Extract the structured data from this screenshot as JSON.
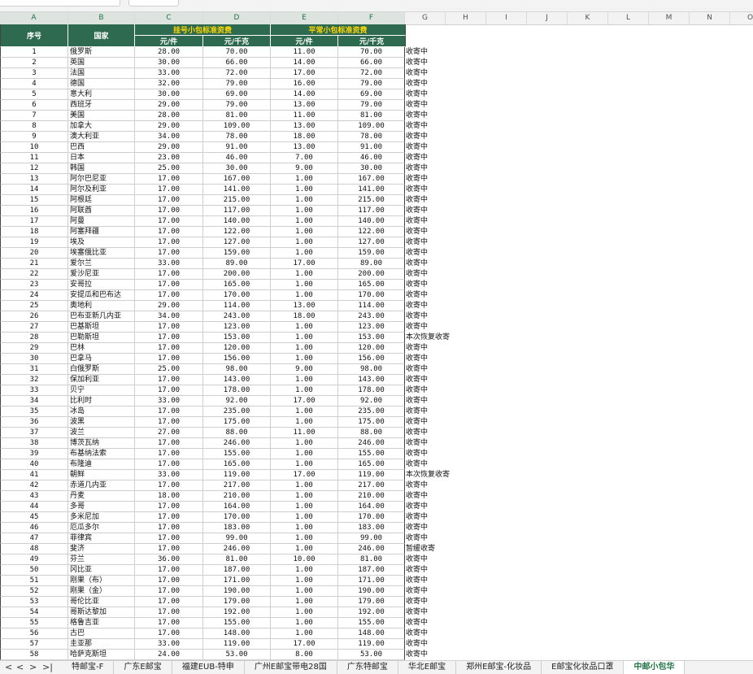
{
  "columns": [
    "A",
    "B",
    "C",
    "D",
    "E",
    "F",
    "G",
    "H",
    "I",
    "J",
    "K",
    "L",
    "M",
    "N",
    "O"
  ],
  "header": {
    "seq": "序号",
    "country": "国家",
    "group1": "挂号小包标准资费",
    "group2": "平常小包标准资费",
    "unit_piece": "元/件",
    "unit_kg": "元/千克"
  },
  "rows": [
    [
      "1",
      "俄罗斯",
      "28.00",
      "70.00",
      "11.00",
      "70.00",
      "收寄中"
    ],
    [
      "2",
      "英国",
      "30.00",
      "66.00",
      "14.00",
      "66.00",
      "收寄中"
    ],
    [
      "3",
      "法国",
      "33.00",
      "72.00",
      "17.00",
      "72.00",
      "收寄中"
    ],
    [
      "4",
      "德国",
      "32.00",
      "79.00",
      "16.00",
      "79.00",
      "收寄中"
    ],
    [
      "5",
      "意大利",
      "30.00",
      "69.00",
      "14.00",
      "69.00",
      "收寄中"
    ],
    [
      "6",
      "西班牙",
      "29.00",
      "79.00",
      "13.00",
      "79.00",
      "收寄中"
    ],
    [
      "7",
      "美国",
      "28.00",
      "81.00",
      "11.00",
      "81.00",
      "收寄中"
    ],
    [
      "8",
      "加拿大",
      "29.00",
      "109.00",
      "13.00",
      "109.00",
      "收寄中"
    ],
    [
      "9",
      "澳大利亚",
      "34.00",
      "78.00",
      "18.00",
      "78.00",
      "收寄中"
    ],
    [
      "10",
      "巴西",
      "29.00",
      "91.00",
      "13.00",
      "91.00",
      "收寄中"
    ],
    [
      "11",
      "日本",
      "23.00",
      "46.00",
      "7.00",
      "46.00",
      "收寄中"
    ],
    [
      "12",
      "韩国",
      "25.00",
      "30.00",
      "9.00",
      "30.00",
      "收寄中"
    ],
    [
      "13",
      "阿尔巴尼亚",
      "17.00",
      "167.00",
      "1.00",
      "167.00",
      "收寄中"
    ],
    [
      "14",
      "阿尔及利亚",
      "17.00",
      "141.00",
      "1.00",
      "141.00",
      "收寄中"
    ],
    [
      "15",
      "阿根廷",
      "17.00",
      "215.00",
      "1.00",
      "215.00",
      "收寄中"
    ],
    [
      "16",
      "阿联酋",
      "17.00",
      "117.00",
      "1.00",
      "117.00",
      "收寄中"
    ],
    [
      "17",
      "阿曼",
      "17.00",
      "140.00",
      "1.00",
      "140.00",
      "收寄中"
    ],
    [
      "18",
      "阿塞拜疆",
      "17.00",
      "122.00",
      "1.00",
      "122.00",
      "收寄中"
    ],
    [
      "19",
      "埃及",
      "17.00",
      "127.00",
      "1.00",
      "127.00",
      "收寄中"
    ],
    [
      "20",
      "埃塞俄比亚",
      "17.00",
      "159.00",
      "1.00",
      "159.00",
      "收寄中"
    ],
    [
      "21",
      "爱尔兰",
      "33.00",
      "89.00",
      "17.00",
      "89.00",
      "收寄中"
    ],
    [
      "22",
      "爱沙尼亚",
      "17.00",
      "200.00",
      "1.00",
      "200.00",
      "收寄中"
    ],
    [
      "23",
      "安哥拉",
      "17.00",
      "165.00",
      "1.00",
      "165.00",
      "收寄中"
    ],
    [
      "24",
      "安提瓜和巴布达",
      "17.00",
      "170.00",
      "1.00",
      "170.00",
      "收寄中"
    ],
    [
      "25",
      "奥地利",
      "29.00",
      "114.00",
      "13.00",
      "114.00",
      "收寄中"
    ],
    [
      "26",
      "巴布亚新几内亚",
      "34.00",
      "243.00",
      "18.00",
      "243.00",
      "收寄中"
    ],
    [
      "27",
      "巴基斯坦",
      "17.00",
      "123.00",
      "1.00",
      "123.00",
      "收寄中"
    ],
    [
      "28",
      "巴勒斯坦",
      "17.00",
      "153.00",
      "1.00",
      "153.00",
      "本次恢复收寄"
    ],
    [
      "29",
      "巴林",
      "17.00",
      "120.00",
      "1.00",
      "120.00",
      "收寄中"
    ],
    [
      "30",
      "巴拿马",
      "17.00",
      "156.00",
      "1.00",
      "156.00",
      "收寄中"
    ],
    [
      "31",
      "白俄罗斯",
      "25.00",
      "98.00",
      "9.00",
      "98.00",
      "收寄中"
    ],
    [
      "32",
      "保加利亚",
      "17.00",
      "143.00",
      "1.00",
      "143.00",
      "收寄中"
    ],
    [
      "33",
      "贝宁",
      "17.00",
      "178.00",
      "1.00",
      "178.00",
      "收寄中"
    ],
    [
      "34",
      "比利时",
      "33.00",
      "92.00",
      "17.00",
      "92.00",
      "收寄中"
    ],
    [
      "35",
      "冰岛",
      "17.00",
      "235.00",
      "1.00",
      "235.00",
      "收寄中"
    ],
    [
      "36",
      "波黑",
      "17.00",
      "175.00",
      "1.00",
      "175.00",
      "收寄中"
    ],
    [
      "37",
      "波兰",
      "27.00",
      "88.00",
      "11.00",
      "88.00",
      "收寄中"
    ],
    [
      "38",
      "博茨瓦纳",
      "17.00",
      "246.00",
      "1.00",
      "246.00",
      "收寄中"
    ],
    [
      "39",
      "布基纳法索",
      "17.00",
      "155.00",
      "1.00",
      "155.00",
      "收寄中"
    ],
    [
      "40",
      "布隆迪",
      "17.00",
      "165.00",
      "1.00",
      "165.00",
      "收寄中"
    ],
    [
      "41",
      "朝鲜",
      "33.00",
      "119.00",
      "17.00",
      "119.00",
      "本次恢复收寄"
    ],
    [
      "42",
      "赤道几内亚",
      "17.00",
      "217.00",
      "1.00",
      "217.00",
      "收寄中"
    ],
    [
      "43",
      "丹麦",
      "18.00",
      "210.00",
      "1.00",
      "210.00",
      "收寄中"
    ],
    [
      "44",
      "多哥",
      "17.00",
      "164.00",
      "1.00",
      "164.00",
      "收寄中"
    ],
    [
      "45",
      "多米尼加",
      "17.00",
      "170.00",
      "1.00",
      "170.00",
      "收寄中"
    ],
    [
      "46",
      "厄瓜多尔",
      "17.00",
      "183.00",
      "1.00",
      "183.00",
      "收寄中"
    ],
    [
      "47",
      "菲律宾",
      "17.00",
      "99.00",
      "1.00",
      "99.00",
      "收寄中"
    ],
    [
      "48",
      "斐济",
      "17.00",
      "246.00",
      "1.00",
      "246.00",
      "暂缓收寄"
    ],
    [
      "49",
      "芬兰",
      "36.00",
      "81.00",
      "10.00",
      "81.00",
      "收寄中"
    ],
    [
      "50",
      "冈比亚",
      "17.00",
      "187.00",
      "1.00",
      "187.00",
      "收寄中"
    ],
    [
      "51",
      "刚果（布）",
      "17.00",
      "171.00",
      "1.00",
      "171.00",
      "收寄中"
    ],
    [
      "52",
      "刚果（金）",
      "17.00",
      "190.00",
      "1.00",
      "190.00",
      "收寄中"
    ],
    [
      "53",
      "哥伦比亚",
      "17.00",
      "179.00",
      "1.00",
      "179.00",
      "收寄中"
    ],
    [
      "54",
      "哥斯达黎加",
      "17.00",
      "192.00",
      "1.00",
      "192.00",
      "收寄中"
    ],
    [
      "55",
      "格鲁吉亚",
      "17.00",
      "155.00",
      "1.00",
      "155.00",
      "收寄中"
    ],
    [
      "56",
      "古巴",
      "17.00",
      "148.00",
      "1.00",
      "148.00",
      "收寄中"
    ],
    [
      "57",
      "圭亚那",
      "33.00",
      "119.00",
      "17.00",
      "119.00",
      "收寄中"
    ],
    [
      "58",
      "哈萨克斯坦",
      "24.00",
      "53.00",
      "8.00",
      "53.00",
      "收寄中"
    ]
  ],
  "tabs": [
    "特邮宝-F",
    "广东E邮宝",
    "福建EUB-特申",
    "广州E邮宝带电28国",
    "广东特邮宝",
    "华北E邮宝",
    "郑州E邮宝-化妆品",
    "E邮宝化妆品口罩",
    "中邮小包华"
  ],
  "active_tab_index": 8,
  "nav_icons": [
    "first-sheet-icon",
    "prev-sheet-icon",
    "next-sheet-icon",
    "last-sheet-icon"
  ],
  "nav_glyphs": [
    "<",
    "<",
    ">",
    ">|"
  ],
  "colors": {
    "header_bg": "#2e6a4f",
    "group_text": "#ffd800",
    "active_tab": "#217346"
  }
}
